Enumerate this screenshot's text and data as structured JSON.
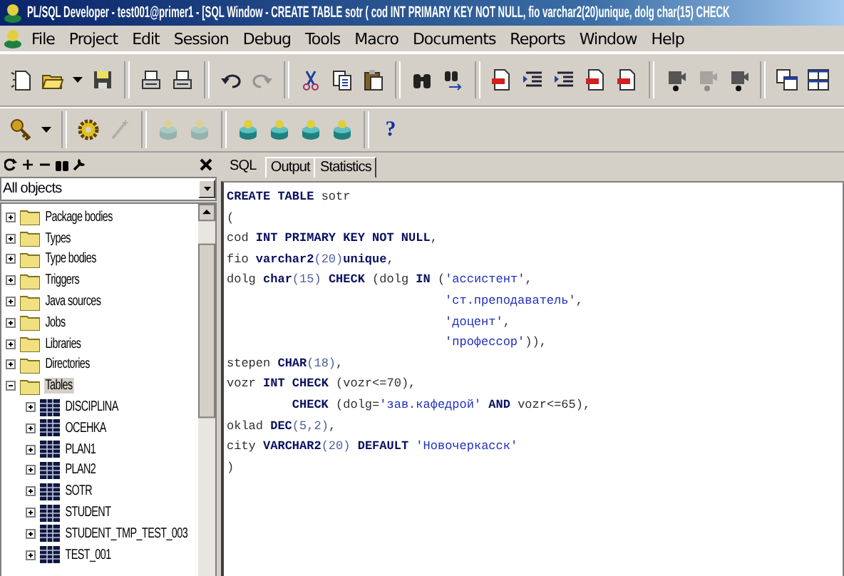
{
  "window": {
    "title": "PL/SQL Developer - test001@primer1 - [SQL Window - CREATE TABLE sotr ( cod INT PRIMARY KEY NOT NULL, fio varchar2(20)unique, dolg char(15) CHECK"
  },
  "menu": [
    "File",
    "Project",
    "Edit",
    "Session",
    "Debug",
    "Tools",
    "Macro",
    "Documents",
    "Reports",
    "Window",
    "Help"
  ],
  "toolbar_main": [
    {
      "kind": "new",
      "disabled": false
    },
    {
      "kind": "open",
      "disabled": false
    },
    {
      "kind": "dropdown",
      "disabled": false
    },
    {
      "kind": "save",
      "disabled": false
    },
    {
      "kind": "separator"
    },
    {
      "kind": "print",
      "disabled": false
    },
    {
      "kind": "print",
      "disabled": false
    },
    {
      "kind": "separator"
    },
    {
      "kind": "undo",
      "disabled": false
    },
    {
      "kind": "redo",
      "disabled": true
    },
    {
      "kind": "separator"
    },
    {
      "kind": "cut",
      "disabled": false
    },
    {
      "kind": "copy",
      "disabled": false
    },
    {
      "kind": "paste",
      "disabled": false
    },
    {
      "kind": "separator"
    },
    {
      "kind": "find",
      "disabled": false
    },
    {
      "kind": "findnext",
      "disabled": false
    },
    {
      "kind": "separator"
    },
    {
      "kind": "document",
      "disabled": false
    },
    {
      "kind": "indent",
      "disabled": false
    },
    {
      "kind": "indent",
      "disabled": false
    },
    {
      "kind": "document",
      "disabled": false
    },
    {
      "kind": "document",
      "disabled": false
    },
    {
      "kind": "separator"
    },
    {
      "kind": "run",
      "disabled": false
    },
    {
      "kind": "run",
      "disabled": true
    },
    {
      "kind": "run",
      "disabled": false
    },
    {
      "kind": "separator"
    },
    {
      "kind": "windows",
      "disabled": false
    },
    {
      "kind": "tile",
      "disabled": false
    }
  ],
  "toolbar_secondary": [
    {
      "kind": "key",
      "disabled": false
    },
    {
      "kind": "dropdown",
      "disabled": false
    },
    {
      "kind": "separator"
    },
    {
      "kind": "gear",
      "disabled": false
    },
    {
      "kind": "wand",
      "disabled": true
    },
    {
      "kind": "separator"
    },
    {
      "kind": "database",
      "disabled": true
    },
    {
      "kind": "database",
      "disabled": true
    },
    {
      "kind": "separator"
    },
    {
      "kind": "database",
      "disabled": false
    },
    {
      "kind": "database",
      "disabled": false
    },
    {
      "kind": "database",
      "disabled": false
    },
    {
      "kind": "database",
      "disabled": false
    },
    {
      "kind": "separator"
    },
    {
      "kind": "help",
      "disabled": false,
      "label": "?"
    }
  ],
  "browser": {
    "filter": "All objects",
    "tree": [
      {
        "label": "Package bodies",
        "kind": "folder",
        "expanded": false,
        "selected": false
      },
      {
        "label": "Types",
        "kind": "folder",
        "expanded": false,
        "selected": false
      },
      {
        "label": "Type bodies",
        "kind": "folder",
        "expanded": false,
        "selected": false
      },
      {
        "label": "Triggers",
        "kind": "folder",
        "expanded": false,
        "selected": false
      },
      {
        "label": "Java sources",
        "kind": "folder",
        "expanded": false,
        "selected": false
      },
      {
        "label": "Jobs",
        "kind": "folder",
        "expanded": false,
        "selected": false
      },
      {
        "label": "Libraries",
        "kind": "folder",
        "expanded": false,
        "selected": false
      },
      {
        "label": "Directories",
        "kind": "folder",
        "expanded": false,
        "selected": false
      },
      {
        "label": "Tables",
        "kind": "folder",
        "expanded": true,
        "selected": true,
        "children": [
          {
            "label": "DISCIPLINA",
            "kind": "table",
            "expanded": false,
            "selected": false
          },
          {
            "label": "OCEHKA",
            "kind": "table",
            "expanded": false,
            "selected": false
          },
          {
            "label": "PLAN1",
            "kind": "table",
            "expanded": false,
            "selected": false
          },
          {
            "label": "PLAN2",
            "kind": "table",
            "expanded": false,
            "selected": false
          },
          {
            "label": "SOTR",
            "kind": "table",
            "expanded": false,
            "selected": false
          },
          {
            "label": "STUDENT",
            "kind": "table",
            "expanded": false,
            "selected": false
          },
          {
            "label": "STUDENT_TMP_TEST_003",
            "kind": "table",
            "expanded": false,
            "selected": false
          },
          {
            "label": "TEST_001",
            "kind": "table",
            "expanded": false,
            "selected": false
          }
        ]
      }
    ]
  },
  "tabs": [
    {
      "label": "SQL",
      "selected": true
    },
    {
      "label": "Output",
      "selected": false
    },
    {
      "label": "Statistics",
      "selected": false
    }
  ],
  "editor": {
    "lines": [
      [
        {
          "text": "CREATE TABLE",
          "kind": "keyword"
        },
        {
          "text": " sotr",
          "kind": "plain"
        }
      ],
      [
        {
          "text": "(",
          "kind": "plain"
        }
      ],
      [
        {
          "text": "cod ",
          "kind": "plain"
        },
        {
          "text": "INT PRIMARY KEY NOT NULL",
          "kind": "keyword"
        },
        {
          "text": ",",
          "kind": "plain"
        }
      ],
      [
        {
          "text": "fio ",
          "kind": "plain"
        },
        {
          "text": "varchar2",
          "kind": "keyword"
        },
        {
          "text": "(20)",
          "kind": "number"
        },
        {
          "text": "unique",
          "kind": "keyword"
        },
        {
          "text": ",",
          "kind": "plain"
        }
      ],
      [
        {
          "text": "dolg ",
          "kind": "plain"
        },
        {
          "text": "char",
          "kind": "keyword"
        },
        {
          "text": "(15) ",
          "kind": "number"
        },
        {
          "text": "CHECK",
          "kind": "keyword"
        },
        {
          "text": " (dolg ",
          "kind": "plain"
        },
        {
          "text": "IN",
          "kind": "keyword"
        },
        {
          "text": " (",
          "kind": "plain"
        },
        {
          "text": "'ассистент'",
          "kind": "string"
        },
        {
          "text": ",",
          "kind": "plain"
        }
      ],
      [
        {
          "text": "                              'ст.преподаватель'",
          "kind": "string"
        },
        {
          "text": ",",
          "kind": "plain"
        }
      ],
      [
        {
          "text": "                              'доцент'",
          "kind": "string"
        },
        {
          "text": ",",
          "kind": "plain"
        }
      ],
      [
        {
          "text": "                              'профессор'",
          "kind": "string"
        },
        {
          "text": ")),",
          "kind": "plain"
        }
      ],
      [
        {
          "text": "stepen ",
          "kind": "plain"
        },
        {
          "text": "CHAR",
          "kind": "keyword"
        },
        {
          "text": "(18)",
          "kind": "number"
        },
        {
          "text": ",",
          "kind": "plain"
        }
      ],
      [
        {
          "text": "vozr ",
          "kind": "plain"
        },
        {
          "text": "INT CHECK",
          "kind": "keyword"
        },
        {
          "text": " (vozr<=70),",
          "kind": "plain"
        }
      ],
      [
        {
          "text": "         CHECK",
          "kind": "keyword"
        },
        {
          "text": " (dolg=",
          "kind": "plain"
        },
        {
          "text": "'зав.кафедрой'",
          "kind": "string"
        },
        {
          "text": " AND",
          "kind": "keyword"
        },
        {
          "text": " vozr<=65),",
          "kind": "plain"
        }
      ],
      [
        {
          "text": "oklad ",
          "kind": "plain"
        },
        {
          "text": "DEC",
          "kind": "keyword"
        },
        {
          "text": "(5,2)",
          "kind": "number"
        },
        {
          "text": ",",
          "kind": "plain"
        }
      ],
      [
        {
          "text": "city ",
          "kind": "plain"
        },
        {
          "text": "VARCHAR2",
          "kind": "keyword"
        },
        {
          "text": "(20) ",
          "kind": "number"
        },
        {
          "text": "DEFAULT",
          "kind": "keyword"
        },
        {
          "text": " 'Новочеркасск'",
          "kind": "string"
        }
      ],
      [
        {
          "text": ")",
          "kind": "plain"
        }
      ]
    ]
  }
}
